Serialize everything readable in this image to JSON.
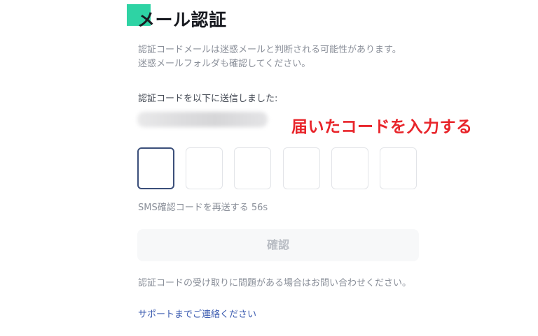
{
  "header": {
    "title": "メール認証",
    "accent_color": "#2ed3a4"
  },
  "description": {
    "line1": "認証コードメールは迷惑メールと判断される可能性があります。",
    "line2": "迷惑メールフォルダも確認してください。"
  },
  "sent_to": {
    "label": "認証コードを以下に送信しました:"
  },
  "annotation": {
    "text": "届いたコードを入力する",
    "color": "#e8242a"
  },
  "code_input": {
    "digits": [
      "",
      "",
      "",
      "",
      "",
      ""
    ]
  },
  "resend": {
    "text": "SMS確認コードを再送する 56s"
  },
  "confirm_button": {
    "label": "確認"
  },
  "help": {
    "text": "認証コードの受け取りに問題がある場合はお問い合わせください。",
    "link_label": "サポートまでご連絡ください",
    "link_color": "#3b5bb0"
  }
}
